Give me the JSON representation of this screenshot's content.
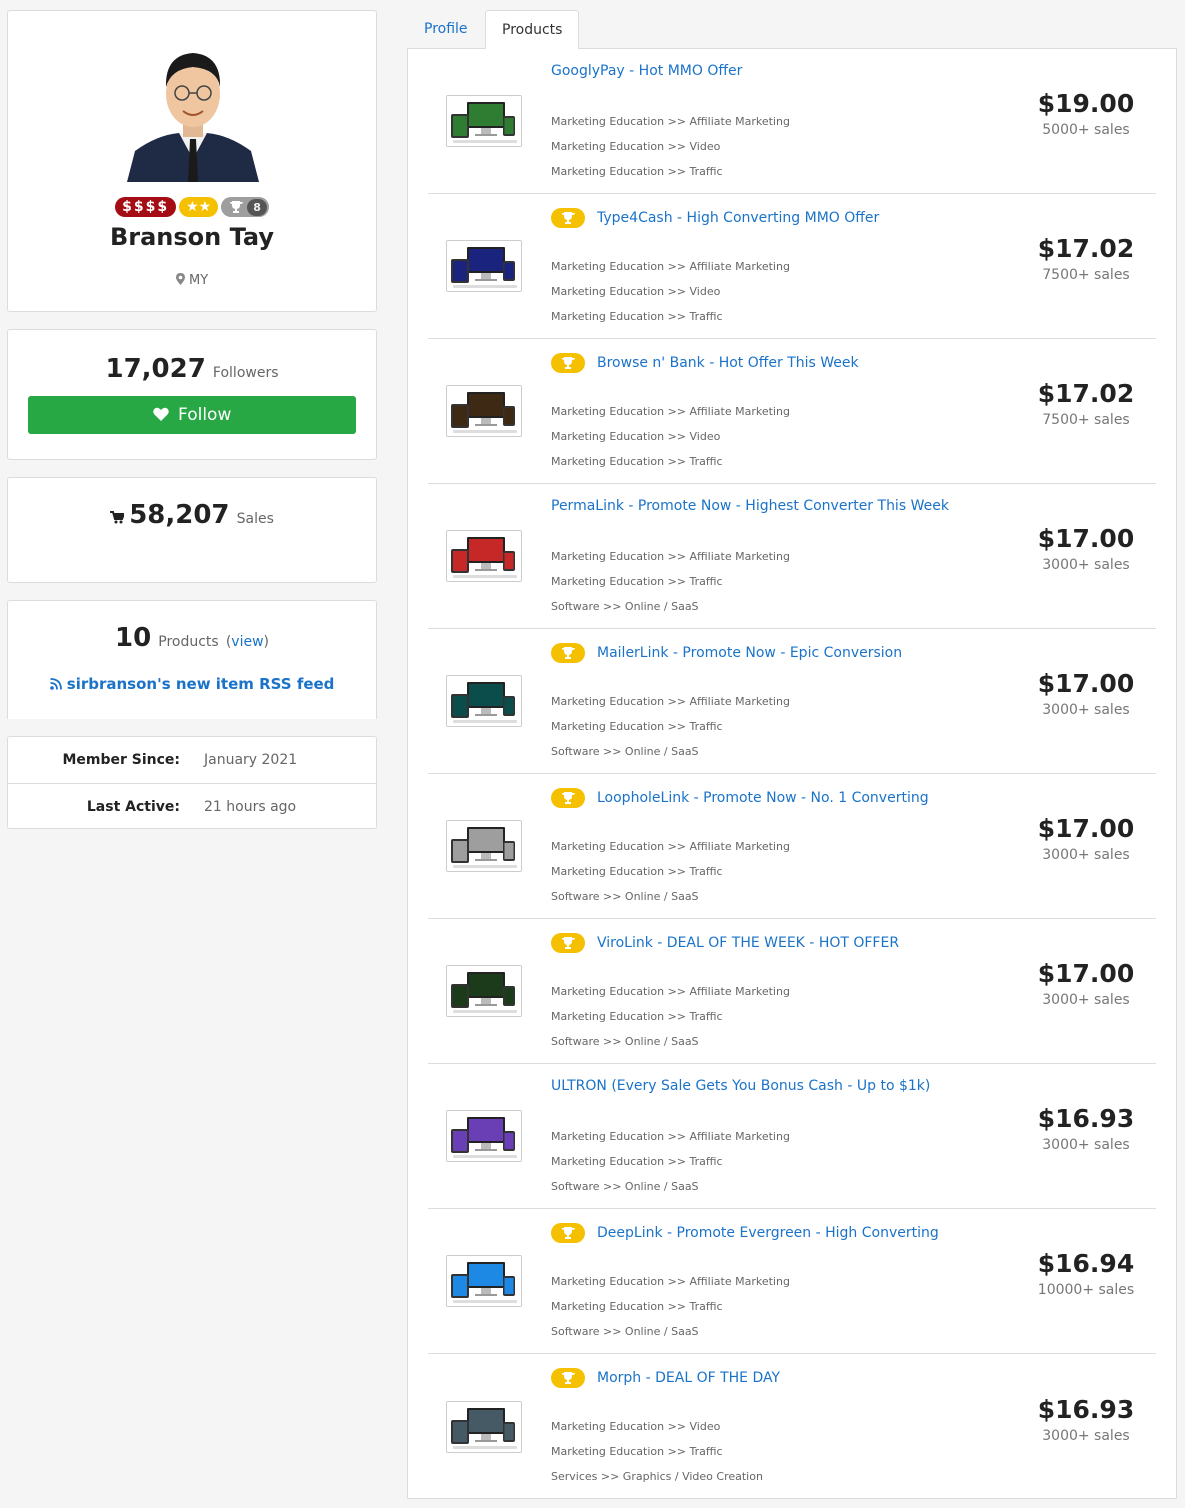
{
  "profile": {
    "money_badge": "$$$$",
    "stars_badge": "★★",
    "trophy_count": "8",
    "name": "Branson Tay",
    "location": "MY"
  },
  "followers": {
    "count": "17,027",
    "label": "Followers",
    "follow_label": "Follow"
  },
  "sales": {
    "count": "58,207",
    "label": "Sales"
  },
  "products_stat": {
    "count": "10",
    "label": "Products",
    "view_open": "(",
    "view_label": "view",
    "view_close": ")",
    "rss_label": "sirbranson's new item RSS feed"
  },
  "meta": {
    "member_since_label": "Member Since:",
    "member_since_value": "January 2021",
    "last_active_label": "Last Active:",
    "last_active_value": "21 hours ago"
  },
  "tabs": [
    "Profile",
    "Products"
  ],
  "products": [
    {
      "title": "GooglyPay - Hot MMO Offer",
      "trophy": false,
      "cats": [
        "Marketing Education >> Affiliate Marketing",
        "Marketing Education >> Video",
        "Marketing Education >> Traffic"
      ],
      "price": "$19.00",
      "sales": "5000+ sales",
      "thumb_color": "#2e7d32"
    },
    {
      "title": "Type4Cash - High Converting MMO Offer",
      "trophy": true,
      "cats": [
        "Marketing Education >> Affiliate Marketing",
        "Marketing Education >> Video",
        "Marketing Education >> Traffic"
      ],
      "price": "$17.02",
      "sales": "7500+ sales",
      "thumb_color": "#1a237e"
    },
    {
      "title": "Browse n' Bank - Hot Offer This Week",
      "trophy": true,
      "cats": [
        "Marketing Education >> Affiliate Marketing",
        "Marketing Education >> Video",
        "Marketing Education >> Traffic"
      ],
      "price": "$17.02",
      "sales": "7500+ sales",
      "thumb_color": "#3e2a14"
    },
    {
      "title": "PermaLink - Promote Now - Highest Converter This Week",
      "trophy": false,
      "cats": [
        "Marketing Education >> Affiliate Marketing",
        "Marketing Education >> Traffic",
        "Software >> Online / SaaS"
      ],
      "price": "$17.00",
      "sales": "3000+ sales",
      "thumb_color": "#c62828"
    },
    {
      "title": "MailerLink - Promote Now - Epic Conversion",
      "trophy": true,
      "cats": [
        "Marketing Education >> Affiliate Marketing",
        "Marketing Education >> Traffic",
        "Software >> Online / SaaS"
      ],
      "price": "$17.00",
      "sales": "3000+ sales",
      "thumb_color": "#0b4d4a"
    },
    {
      "title": "LoopholeLink - Promote Now - No. 1 Converting",
      "trophy": true,
      "cats": [
        "Marketing Education >> Affiliate Marketing",
        "Marketing Education >> Traffic",
        "Software >> Online / SaaS"
      ],
      "price": "$17.00",
      "sales": "3000+ sales",
      "thumb_color": "#9e9e9e"
    },
    {
      "title": "ViroLink - DEAL OF THE WEEK - HOT OFFER",
      "trophy": true,
      "cats": [
        "Marketing Education >> Affiliate Marketing",
        "Marketing Education >> Traffic",
        "Software >> Online / SaaS"
      ],
      "price": "$17.00",
      "sales": "3000+ sales",
      "thumb_color": "#1b3b1b"
    },
    {
      "title": "ULTRON (Every Sale Gets You Bonus Cash - Up to $1k)",
      "trophy": false,
      "cats": [
        "Marketing Education >> Affiliate Marketing",
        "Marketing Education >> Traffic",
        "Software >> Online / SaaS"
      ],
      "price": "$16.93",
      "sales": "3000+ sales",
      "thumb_color": "#6a3fb5"
    },
    {
      "title": "DeepLink - Promote Evergreen - High Converting",
      "trophy": true,
      "cats": [
        "Marketing Education >> Affiliate Marketing",
        "Marketing Education >> Traffic",
        "Software >> Online / SaaS"
      ],
      "price": "$16.94",
      "sales": "10000+ sales",
      "thumb_color": "#1e88e5"
    },
    {
      "title": "Morph - DEAL OF THE DAY",
      "trophy": true,
      "cats": [
        "Marketing Education >> Video",
        "Marketing Education >> Traffic",
        "Services >> Graphics / Video Creation"
      ],
      "price": "$16.93",
      "sales": "3000+ sales",
      "thumb_color": "#455a64"
    }
  ],
  "colors": {
    "link": "#1a73c9",
    "follow_green": "#28a745",
    "trophy_gold": "#f5c000",
    "money_red": "#a30d13"
  },
  "icons": [
    "map-marker-icon",
    "heart-icon",
    "cart-icon",
    "rss-icon",
    "trophy-icon",
    "star-icon"
  ]
}
